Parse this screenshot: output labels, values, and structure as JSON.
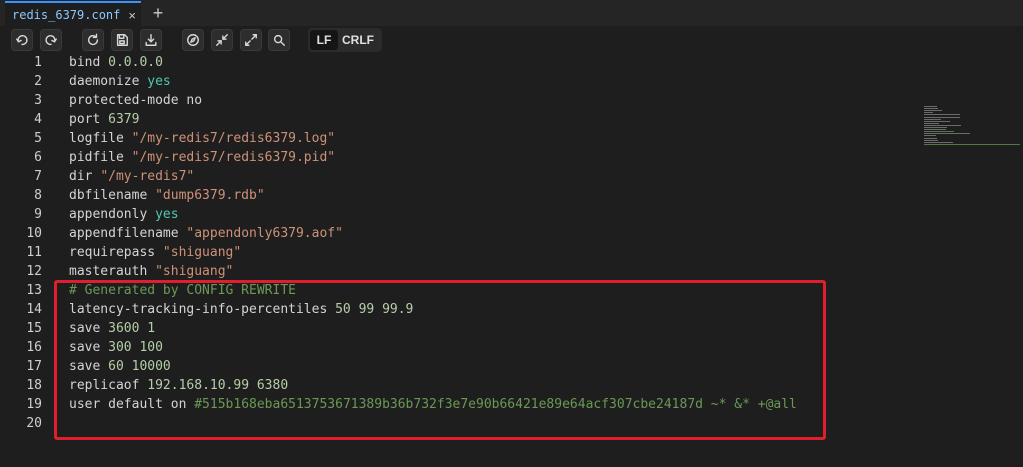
{
  "tab": {
    "title": "redis_6379.conf",
    "close_glyph": "×",
    "add_glyph": "+"
  },
  "toolbar": {
    "icons": [
      "undo-icon",
      "redo-icon",
      "reload-icon",
      "save-icon",
      "download-icon",
      "compass-icon",
      "collapse-icon",
      "expand-icon",
      "search-icon"
    ],
    "eol_options": [
      "LF",
      "CRLF"
    ],
    "eol_selected": "LF"
  },
  "editor": {
    "lines": [
      {
        "n": "1",
        "tokens": [
          {
            "t": "bind ",
            "c": "kw"
          },
          {
            "t": "0.0.0.0",
            "c": "num"
          }
        ]
      },
      {
        "n": "2",
        "tokens": [
          {
            "t": "daemonize ",
            "c": "kw"
          },
          {
            "t": "yes",
            "c": "bool"
          }
        ]
      },
      {
        "n": "3",
        "tokens": [
          {
            "t": "protected-mode no",
            "c": "kw"
          }
        ]
      },
      {
        "n": "4",
        "tokens": [
          {
            "t": "port ",
            "c": "kw"
          },
          {
            "t": "6379",
            "c": "num"
          }
        ]
      },
      {
        "n": "5",
        "tokens": [
          {
            "t": "logfile ",
            "c": "kw"
          },
          {
            "t": "\"/my-redis7/redis6379.log\"",
            "c": "str"
          }
        ]
      },
      {
        "n": "6",
        "tokens": [
          {
            "t": "pidfile ",
            "c": "kw"
          },
          {
            "t": "\"/my-redis7/redis6379.pid\"",
            "c": "str"
          }
        ]
      },
      {
        "n": "7",
        "tokens": [
          {
            "t": "dir ",
            "c": "kw"
          },
          {
            "t": "\"/my-redis7\"",
            "c": "str"
          }
        ]
      },
      {
        "n": "8",
        "tokens": [
          {
            "t": "dbfilename ",
            "c": "kw"
          },
          {
            "t": "\"dump6379.rdb\"",
            "c": "str"
          }
        ]
      },
      {
        "n": "9",
        "tokens": [
          {
            "t": "appendonly ",
            "c": "kw"
          },
          {
            "t": "yes",
            "c": "bool"
          }
        ]
      },
      {
        "n": "10",
        "tokens": [
          {
            "t": "appendfilename ",
            "c": "kw"
          },
          {
            "t": "\"appendonly6379.aof\"",
            "c": "str"
          }
        ]
      },
      {
        "n": "11",
        "tokens": [
          {
            "t": "requirepass ",
            "c": "kw"
          },
          {
            "t": "\"shiguang\"",
            "c": "str"
          }
        ]
      },
      {
        "n": "12",
        "tokens": [
          {
            "t": "masterauth ",
            "c": "kw"
          },
          {
            "t": "\"shiguang\"",
            "c": "str"
          }
        ]
      },
      {
        "n": "13",
        "tokens": [
          {
            "t": "# Generated by CONFIG REWRITE",
            "c": "cmt"
          }
        ]
      },
      {
        "n": "14",
        "tokens": [
          {
            "t": "latency-tracking-info-percentiles ",
            "c": "kw"
          },
          {
            "t": "50 99 99.9",
            "c": "num"
          }
        ]
      },
      {
        "n": "15",
        "tokens": [
          {
            "t": "save ",
            "c": "kw"
          },
          {
            "t": "3600 1",
            "c": "num"
          }
        ]
      },
      {
        "n": "16",
        "tokens": [
          {
            "t": "save ",
            "c": "kw"
          },
          {
            "t": "300 100",
            "c": "num"
          }
        ]
      },
      {
        "n": "17",
        "tokens": [
          {
            "t": "save ",
            "c": "kw"
          },
          {
            "t": "60 10000",
            "c": "num"
          }
        ]
      },
      {
        "n": "18",
        "tokens": [
          {
            "t": "replicaof ",
            "c": "kw"
          },
          {
            "t": "192.168.10.99 6380",
            "c": "num"
          }
        ]
      },
      {
        "n": "19",
        "tokens": [
          {
            "t": "user default on ",
            "c": "kw"
          },
          {
            "t": "#515b168eba6513753671389b36b732f3e7e90b66421e89e64acf307cbe24187d ~* &* +@all",
            "c": "hash"
          }
        ]
      },
      {
        "n": "20",
        "tokens": []
      }
    ]
  },
  "colors": {
    "highlight_box": "#e01e2d",
    "tab_accent": "#3794ff"
  }
}
